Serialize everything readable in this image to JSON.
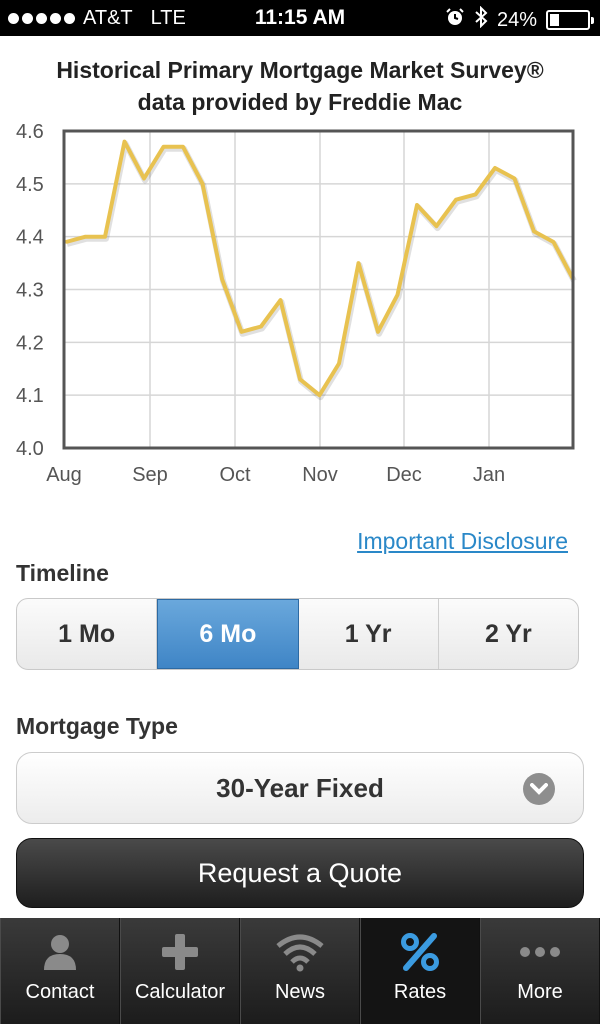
{
  "status_bar": {
    "carrier": "AT&T",
    "network": "LTE",
    "time": "11:15 AM",
    "battery": "24%",
    "battery_level": 0.24
  },
  "chart_title_line1": "Historical Primary Mortgage Market Survey®",
  "chart_title_line2": "data provided by Freddie Mac",
  "chart_data": {
    "type": "line",
    "title": "Historical Primary Mortgage Market Survey® data provided by Freddie Mac",
    "xlabel": "",
    "ylabel": "",
    "ylim": [
      4.0,
      4.6
    ],
    "yticks": [
      "4.6",
      "4.5",
      "4.4",
      "4.3",
      "4.2",
      "4.1",
      "4.0"
    ],
    "xticks": [
      "Aug",
      "Sep",
      "Oct",
      "Nov",
      "Dec",
      "Jan"
    ],
    "grid": true,
    "color": "#e8c250",
    "series": [
      {
        "values": [
          4.39,
          4.4,
          4.4,
          4.58,
          4.51,
          4.57,
          4.57,
          4.5,
          4.32,
          4.22,
          4.23,
          4.28,
          4.13,
          4.1,
          4.16,
          4.35,
          4.22,
          4.29,
          4.46,
          4.42,
          4.47,
          4.48,
          4.53,
          4.51,
          4.41,
          4.39,
          4.32
        ]
      }
    ]
  },
  "disclosure_link": "Important Disclosure",
  "timeline_label": "Timeline",
  "timeline_options": [
    {
      "label": "1 Mo",
      "active": false
    },
    {
      "label": "6 Mo",
      "active": true
    },
    {
      "label": "1 Yr",
      "active": false
    },
    {
      "label": "2 Yr",
      "active": false
    }
  ],
  "mortgage_type_label": "Mortgage Type",
  "mortgage_type_value": "30-Year Fixed",
  "quote_button": "Request a Quote",
  "tabs": [
    {
      "label": "Contact",
      "icon": "person-icon"
    },
    {
      "label": "Calculator",
      "icon": "plus-icon"
    },
    {
      "label": "News",
      "icon": "wifi-icon"
    },
    {
      "label": "Rates",
      "icon": "percent-icon"
    },
    {
      "label": "More",
      "icon": "ellipsis-icon"
    }
  ]
}
